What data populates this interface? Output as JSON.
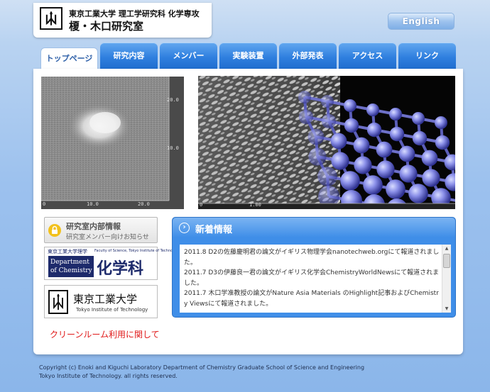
{
  "header": {
    "line1": "東京工業大学 理工学研究科 化学専攻",
    "line2": "榎・木口研究室",
    "english_label": "English"
  },
  "tabs": [
    {
      "label": "トップページ",
      "active": true
    },
    {
      "label": "研究内容"
    },
    {
      "label": "メンバー"
    },
    {
      "label": "実験装置"
    },
    {
      "label": "外部発表"
    },
    {
      "label": "アクセス"
    },
    {
      "label": "リンク"
    }
  ],
  "afm": {
    "right_ticks": [
      "20.0",
      "10.0"
    ],
    "bottom_ticks": [
      "0",
      "10.0",
      "20.0"
    ]
  },
  "molecule": {
    "bottom_ticks": [
      "0",
      "1.00"
    ]
  },
  "internal": {
    "title": "研究室内部情報",
    "subtitle": "研究室メンバー向けお知らせ"
  },
  "chem": {
    "jp_small": "東京工業大学理学",
    "small_right": "Faculty of Science, Tokyo Institute of Technology",
    "dept_line1": "Department",
    "dept_line2": "of Chemistry",
    "kagaku": "化学科"
  },
  "titech": {
    "jp": "東京工業大学",
    "en": "Tokyo Institute of Technology"
  },
  "cleanroom_label": "クリーンルーム利用に関して",
  "news": {
    "title": "新着情報",
    "items": [
      "2011.8 D2の佐藤慶明君の論文がイギリス物理学会nanotechweb.orgにて報道されました。",
      "2011.7 D3の伊藤良一君の論文がイギリス化学会ChemistryWorldNewsにて報道されました。",
      "2011.7 木口学准教授の論文がNature Asia Materials のHighlight記事およびChemistry Viewsにて報道されました。"
    ]
  },
  "footer": {
    "line1": "Copyright (c) Enoki and Kiguchi Laboratory Department of Chemistry Graduate School of Science and Engineering",
    "line2": "Tokyo Institute of Technology. all rights reserved."
  },
  "colors": {
    "tab_blue": "#2f7fdf",
    "news_blue": "#3f8ee8",
    "link_red": "#e01a1a",
    "navy": "#1d2a6b"
  }
}
